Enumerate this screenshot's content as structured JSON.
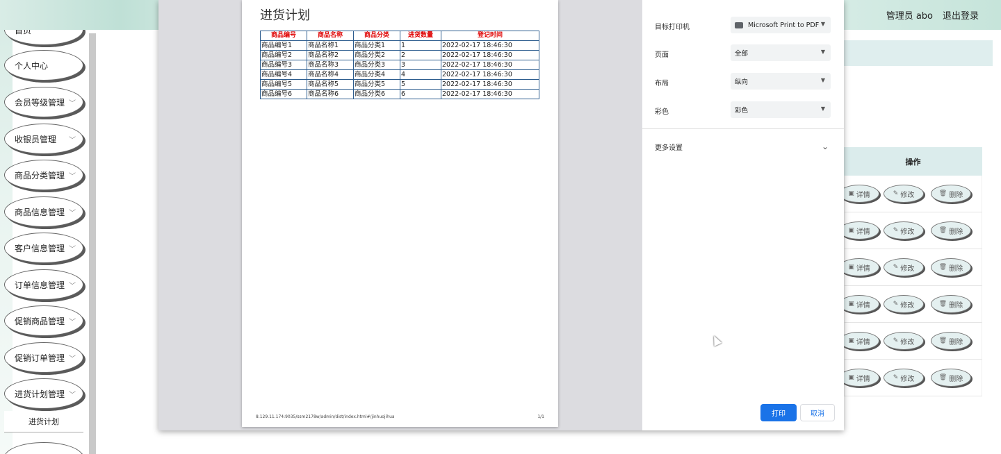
{
  "header": {
    "user_label": "管理员 abo",
    "logout_label": "退出登录"
  },
  "sidebar": {
    "items": [
      {
        "label": "首页"
      },
      {
        "label": "个人中心"
      },
      {
        "label": "会员等级管理"
      },
      {
        "label": "收银员管理"
      },
      {
        "label": "商品分类管理"
      },
      {
        "label": "商品信息管理"
      },
      {
        "label": "客户信息管理"
      },
      {
        "label": "订单信息管理"
      },
      {
        "label": "促销商品管理"
      },
      {
        "label": "促销订单管理"
      },
      {
        "label": "进货计划管理"
      }
    ],
    "submenu": {
      "label": "进货计划"
    }
  },
  "ops": {
    "header": "操作",
    "detail": "详情",
    "edit": "修改",
    "delete": "删除"
  },
  "print_preview": {
    "title": "进货计划",
    "columns": [
      "商品编号",
      "商品名称",
      "商品分类",
      "进货数量",
      "登记时间"
    ],
    "rows": [
      [
        "商品编号1",
        "商品名称1",
        "商品分类1",
        "1",
        "2022-02-17 18:46:30"
      ],
      [
        "商品编号2",
        "商品名称2",
        "商品分类2",
        "2",
        "2022-02-17 18:46:30"
      ],
      [
        "商品编号3",
        "商品名称3",
        "商品分类3",
        "3",
        "2022-02-17 18:46:30"
      ],
      [
        "商品编号4",
        "商品名称4",
        "商品分类4",
        "4",
        "2022-02-17 18:46:30"
      ],
      [
        "商品编号5",
        "商品名称5",
        "商品分类5",
        "5",
        "2022-02-17 18:46:30"
      ],
      [
        "商品编号6",
        "商品名称6",
        "商品分类6",
        "6",
        "2022-02-17 18:46:30"
      ]
    ],
    "footer_url": "8.129.11.174:9035/ssm2178w/admin/dist/index.html#/jinhuojihua",
    "footer_page": "1/1"
  },
  "print_settings": {
    "destination_label": "目标打印机",
    "destination_value": "Microsoft Print to PDF",
    "pages_label": "页面",
    "pages_value": "全部",
    "layout_label": "布局",
    "layout_value": "纵向",
    "color_label": "彩色",
    "color_value": "彩色",
    "more_settings_label": "更多设置",
    "print_button": "打印",
    "cancel_button": "取消"
  },
  "colors": {
    "accent": "#1a73e8",
    "table_header_text": "#e00000",
    "table_border": "#2d5d8f"
  }
}
